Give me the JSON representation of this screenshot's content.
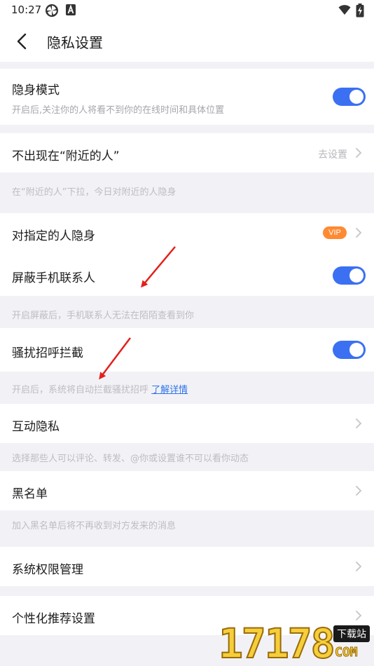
{
  "status_bar": {
    "time": "10:27",
    "icons": [
      "pinwheel-icon",
      "a-badge-icon",
      "wifi-icon",
      "battery-charging-icon"
    ]
  },
  "header": {
    "back_icon": "chevron-left-icon",
    "title": "隐私设置"
  },
  "settings": {
    "invisible_mode": {
      "title": "隐身模式",
      "subtitle": "开启后,关注你的人将看不到你的在线时间和具体位置",
      "toggle_on": true
    },
    "nearby": {
      "title": "不出现在“附近的人”",
      "action": "去设置",
      "hint": "在“附近的人”下拉，今日对附近的人隐身"
    },
    "hide_from_specific": {
      "title": "对指定的人隐身",
      "badge": "VIP"
    },
    "block_contacts": {
      "title": "屏蔽手机联系人",
      "toggle_on": true,
      "hint": "开启屏蔽后，手机联系人无法在陌陌查看到你"
    },
    "harassment_block": {
      "title": "骚扰招呼拦截",
      "toggle_on": true,
      "hint": "开启后，系统将自动拦截骚扰招呼",
      "hint_link": "了解详情"
    },
    "interaction_privacy": {
      "title": "互动隐私",
      "hint": "选择那些人可以评论、转发、@你或设置谁不可以看你动态"
    },
    "blacklist": {
      "title": "黑名单",
      "hint": "加入黑名单后将不再收到对方发来的消息"
    },
    "system_permissions": {
      "title": "系统权限管理"
    },
    "personalized_recommendation": {
      "title": "个性化推荐设置"
    }
  },
  "watermark": {
    "digits": "17178",
    "badge": "下载站",
    "domain": "COM"
  },
  "colors": {
    "toggle_on": "#3b70f2",
    "vip_badge": "#ff8a33",
    "link": "#2f73e8",
    "annotation_arrow": "#e3201b",
    "background": "#f2f2f6"
  }
}
